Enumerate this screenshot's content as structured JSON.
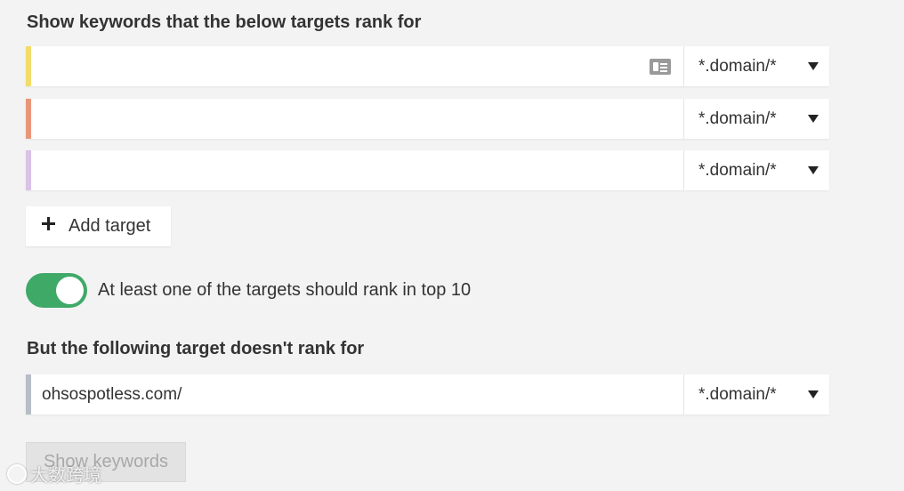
{
  "section1": {
    "title": "Show keywords that the below targets rank for"
  },
  "targets": [
    {
      "value": "",
      "mode": "*.domain/*",
      "bar_color": "#f2dc6b"
    },
    {
      "value": "",
      "mode": "*.domain/*",
      "bar_color": "#e8967a"
    },
    {
      "value": "",
      "mode": "*.domain/*",
      "bar_color": "#d9c2e6"
    }
  ],
  "add_target": {
    "label": "Add target"
  },
  "toggle": {
    "label": "At least one of the targets should rank in top 10",
    "state": "on",
    "color": "#3fa968"
  },
  "section2": {
    "title": "But the following target doesn't rank for"
  },
  "exclude_target": {
    "value": "ohsospotless.com/",
    "mode": "*.domain/*",
    "bar_color": "#b7bdc6"
  },
  "show_button": {
    "label": "Show keywords"
  },
  "watermark": {
    "text": "大数跨境"
  },
  "icons": {
    "contact_card": "contact-card-icon",
    "caret": "caret-down-icon",
    "plus": "plus-icon"
  }
}
